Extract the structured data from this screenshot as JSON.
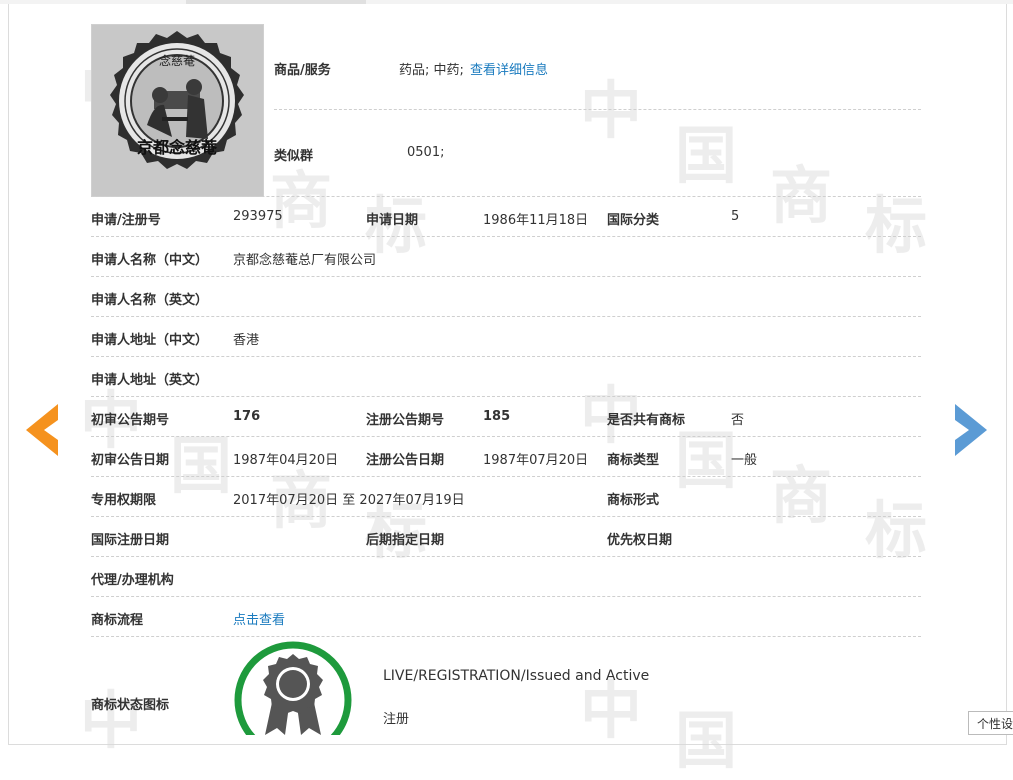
{
  "goods": {
    "label": "商品/服务",
    "value": "药品; 中药;",
    "link": "查看详细信息"
  },
  "similar_group": {
    "label": "类似群",
    "value": "0501;"
  },
  "rows": {
    "app_no": {
      "label": "申请/注册号",
      "value": "293975"
    },
    "app_date": {
      "label": "申请日期",
      "value": "1986年11月18日"
    },
    "intl_class": {
      "label": "国际分类",
      "value": "5"
    },
    "applicant_cn": {
      "label": "申请人名称（中文）",
      "value": "京都念慈菴总厂有限公司"
    },
    "applicant_en": {
      "label": "申请人名称（英文）",
      "value": ""
    },
    "address_cn": {
      "label": "申请人地址（中文）",
      "value": "香港"
    },
    "address_en": {
      "label": "申请人地址（英文）",
      "value": ""
    },
    "prelim_issue": {
      "label": "初审公告期号",
      "value": "176"
    },
    "reg_issue": {
      "label": "注册公告期号",
      "value": "185"
    },
    "shared": {
      "label": "是否共有商标",
      "value": "否"
    },
    "prelim_date": {
      "label": "初审公告日期",
      "value": "1987年04月20日"
    },
    "reg_date": {
      "label": "注册公告日期",
      "value": "1987年07月20日"
    },
    "tm_type": {
      "label": "商标类型",
      "value": "一般"
    },
    "exclusive_period": {
      "label": "专用权期限",
      "value": "2017年07月20日 至 2027年07月19日"
    },
    "tm_form": {
      "label": "商标形式",
      "value": ""
    },
    "intl_reg_date": {
      "label": "国际注册日期",
      "value": ""
    },
    "later_designation": {
      "label": "后期指定日期",
      "value": ""
    },
    "priority_date": {
      "label": "优先权日期",
      "value": ""
    },
    "agency": {
      "label": "代理/办理机构",
      "value": ""
    },
    "process": {
      "label": "商标流程",
      "link": "点击查看"
    },
    "status_icon": {
      "label": "商标状态图标"
    }
  },
  "status": {
    "english": "LIVE/REGISTRATION/Issued and Active",
    "chinese": "注册"
  },
  "logo_text": {
    "top": "念慈菴",
    "bottom": "京都念慈菴"
  },
  "watermark": [
    "中",
    "国",
    "商",
    "标"
  ],
  "corner_button": "个性设",
  "colors": {
    "link": "#1a7bbf",
    "prev_arrow": "#f5921e",
    "next_arrow": "#5b9bd5",
    "badge_ring": "#1e9a3c",
    "badge_medal": "#555555"
  },
  "icons": {
    "prev": "chevron-left-icon",
    "next": "chevron-right-icon",
    "status": "award-ribbon-icon"
  }
}
